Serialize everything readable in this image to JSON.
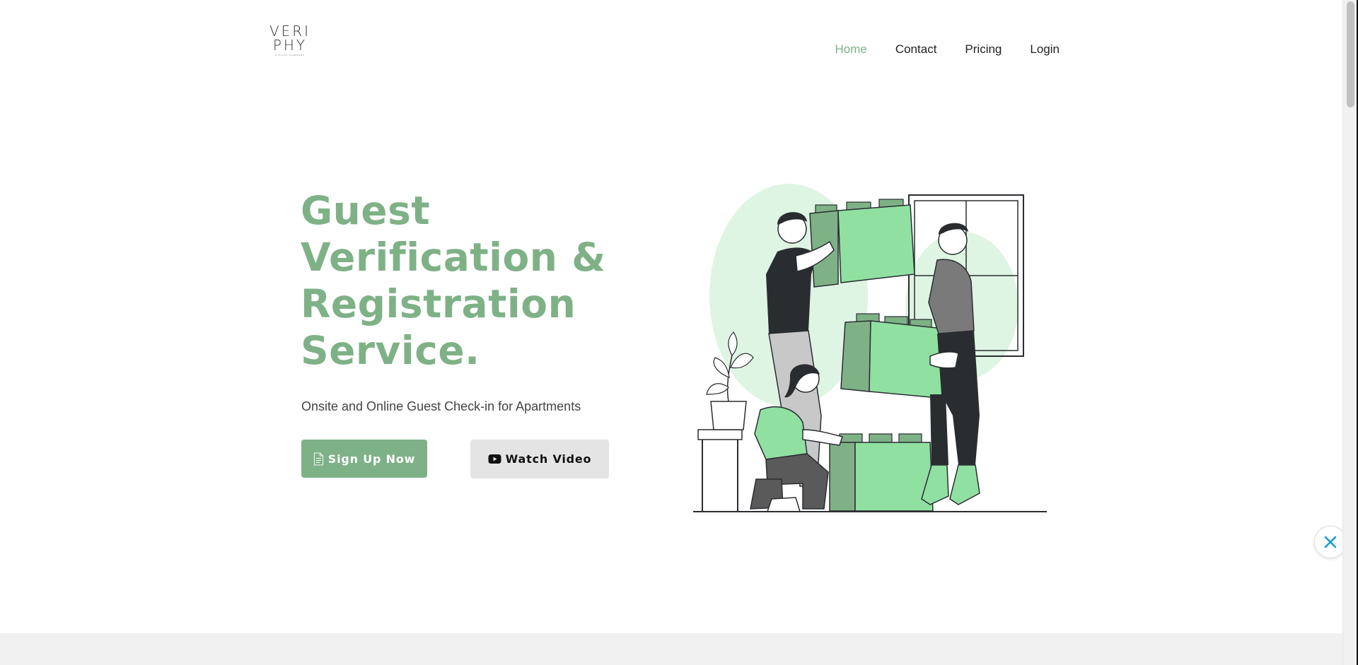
{
  "logo": {
    "line1": "VERI",
    "line2": "PHY",
    "tagline": "A PILOT COMPANY"
  },
  "nav": {
    "items": [
      {
        "label": "Home",
        "active": true
      },
      {
        "label": "Contact",
        "active": false
      },
      {
        "label": "Pricing",
        "active": false
      },
      {
        "label": "Login",
        "active": false
      }
    ]
  },
  "hero": {
    "title_lines": [
      "Guest",
      "Verification &",
      "Registration",
      "Service."
    ],
    "subtitle": "Onsite and Online Guest Check-in for Apartments",
    "signup_label": "Sign Up Now",
    "signup_icon": "document-icon",
    "video_label": "Watch Video",
    "video_icon": "youtube-icon"
  },
  "illustration": {
    "icon": "people-stacking-boxes-illustration"
  },
  "floating_widget": {
    "icon": "close-x-icon"
  },
  "colors": {
    "accent": "#7fb187",
    "accent_light": "#90e0a2",
    "pale": "#def5e3",
    "dark": "#2a2d30",
    "button_grey": "#e4e4e4",
    "band": "#f1f1f1",
    "widget": "#1a9ad6"
  }
}
